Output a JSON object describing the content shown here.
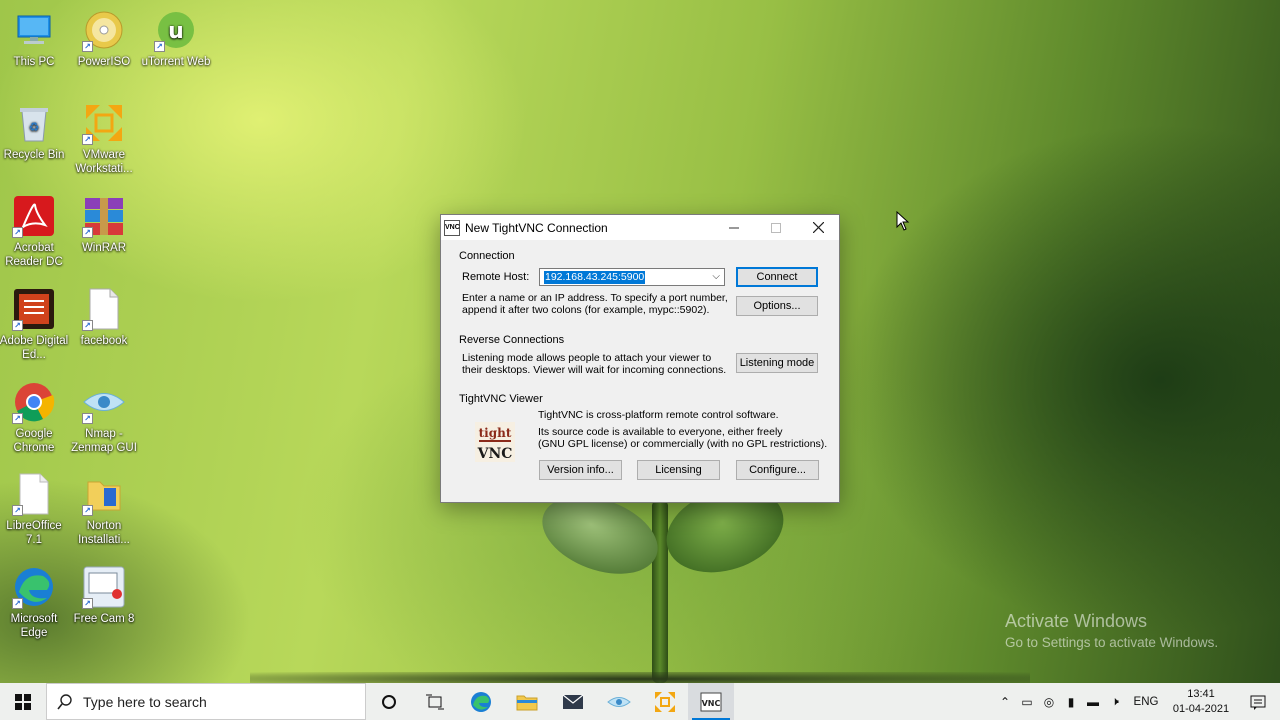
{
  "desktop": {
    "icons": [
      {
        "label": "This PC",
        "icon": "computer-icon"
      },
      {
        "label": "PowerISO",
        "icon": "disc-icon"
      },
      {
        "label": "uTorrent Web",
        "icon": "utorrent-icon"
      },
      {
        "label": "Recycle Bin",
        "icon": "recycle-bin-icon"
      },
      {
        "label": "VMware Workstati...",
        "icon": "vmware-icon"
      },
      {
        "label": "Acrobat Reader DC",
        "icon": "acrobat-icon"
      },
      {
        "label": "WinRAR",
        "icon": "winrar-icon"
      },
      {
        "label": "Adobe Digital Ed...",
        "icon": "digital-editions-icon"
      },
      {
        "label": "facebook",
        "icon": "document-icon"
      },
      {
        "label": "Google Chrome",
        "icon": "chrome-icon"
      },
      {
        "label": "Nmap - Zenmap GUI",
        "icon": "nmap-eye-icon"
      },
      {
        "label": "LibreOffice 7.1",
        "icon": "libreoffice-icon"
      },
      {
        "label": "Norton Installati...",
        "icon": "folder-icon"
      },
      {
        "label": "Microsoft Edge",
        "icon": "edge-icon"
      },
      {
        "label": "Free Cam 8",
        "icon": "freecam-icon"
      }
    ],
    "watermark": {
      "title": "Activate Windows",
      "subtitle": "Go to Settings to activate Windows."
    }
  },
  "dialog": {
    "title": "New TightVNC Connection",
    "connection": {
      "group_label": "Connection",
      "host_label": "Remote Host:",
      "host_value": "192.168.43.245:5900",
      "help_line1": "Enter a name or an IP address. To specify a port number,",
      "help_line2": "append it after two colons (for example, mypc::5902).",
      "connect_label": "Connect",
      "options_label": "Options..."
    },
    "reverse": {
      "group_label": "Reverse Connections",
      "text_line1": "Listening mode allows people to attach your viewer to",
      "text_line2": "their desktops. Viewer will wait for incoming connections.",
      "listen_label": "Listening mode"
    },
    "viewer": {
      "group_label": "TightVNC Viewer",
      "text_line1": "TightVNC is cross-platform remote control software.",
      "text_line2": "Its source code is available to everyone, either freely",
      "text_line3": "(GNU GPL license) or commercially (with no GPL restrictions).",
      "logo_top": "tight",
      "logo_bottom": "VNC",
      "version_label": "Version info...",
      "licensing_label": "Licensing",
      "configure_label": "Configure..."
    }
  },
  "taskbar": {
    "search_placeholder": "Type here to search",
    "apps": [
      "cortana-icon",
      "task-view-icon",
      "edge-icon",
      "file-explorer-icon",
      "mail-icon",
      "nmap-eye-icon",
      "vmware-icon",
      "tightvnc-icon"
    ],
    "language": "ENG",
    "time": "13:41",
    "date": "01-04-2021"
  }
}
